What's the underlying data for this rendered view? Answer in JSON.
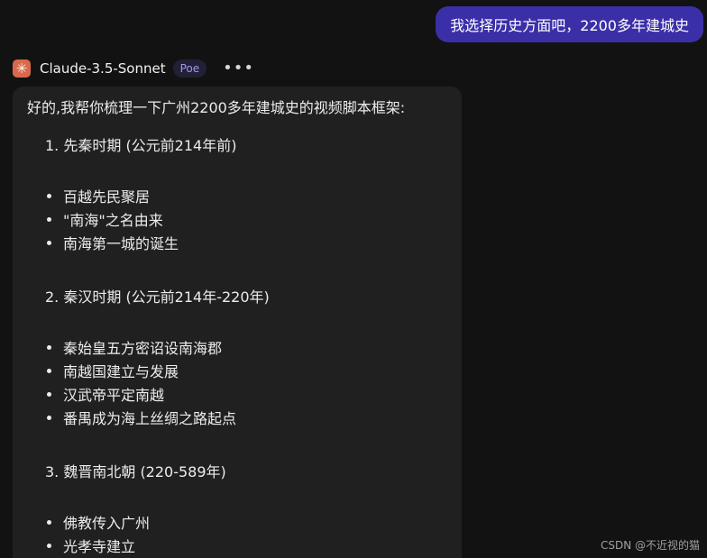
{
  "user_message": "我选择历史方面吧，2200多年建城史",
  "bot": {
    "avatar_icon": "sparkle-icon",
    "name": "Claude-3.5-Sonnet",
    "badge": "Poe",
    "more_label": "•••"
  },
  "response": {
    "intro": "好的,我帮你梳理一下广州2200多年建城史的视频脚本框架:",
    "sections": [
      {
        "heading": "1. 先秦时期 (公元前214年前)",
        "bullets": [
          "百越先民聚居",
          "\"南海\"之名由来",
          "南海第一城的诞生"
        ]
      },
      {
        "heading": "2. 秦汉时期 (公元前214年-220年)",
        "bullets": [
          "秦始皇五方密诏设南海郡",
          "南越国建立与发展",
          "汉武帝平定南越",
          "番禺成为海上丝绸之路起点"
        ]
      },
      {
        "heading": "3. 魏晋南北朝 (220-589年)",
        "bullets": [
          "佛教传入广州",
          "光孝寺建立"
        ]
      }
    ]
  },
  "watermark": "CSDN @不近视的猫",
  "colors": {
    "background": "#121212",
    "user_bubble": "#3b2fa8",
    "card": "#202020",
    "avatar": "#d9694a",
    "badge_text": "#9f97f5"
  }
}
